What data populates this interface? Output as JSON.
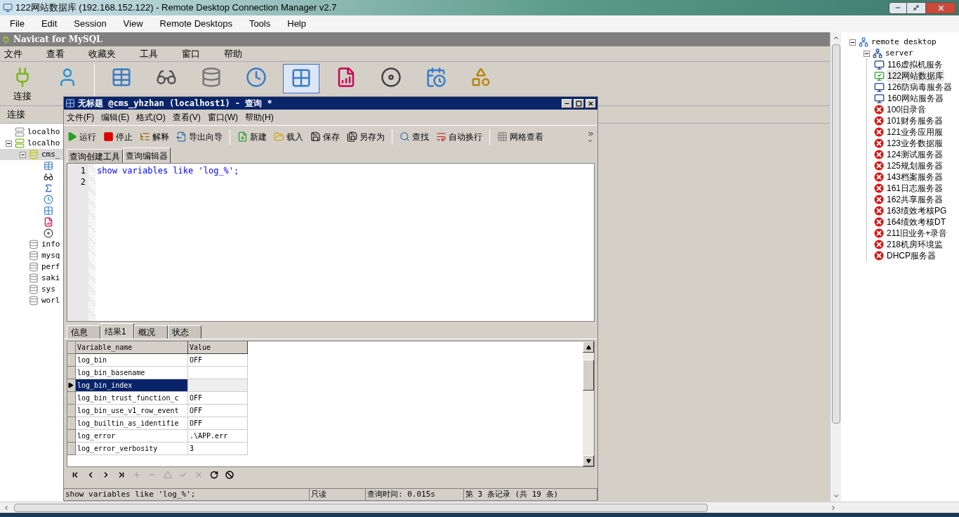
{
  "window": {
    "title": "122网站数据库 (192.168.152.122) - Remote Desktop Connection Manager v2.7"
  },
  "menu": [
    "File",
    "Edit",
    "Session",
    "View",
    "Remote Desktops",
    "Tools",
    "Help"
  ],
  "navicat": {
    "title": "Navicat for MySQL",
    "menu": [
      "文件",
      "查看",
      "收藏夹",
      "工具",
      "窗口",
      "帮助"
    ],
    "toolbar": [
      {
        "kind": "connection",
        "label": "连接",
        "selected": false
      },
      {
        "kind": "user",
        "selected": false
      },
      {
        "kind": "table",
        "selected": false
      },
      {
        "kind": "view",
        "selected": false
      },
      {
        "kind": "function",
        "selected": false
      },
      {
        "kind": "event",
        "selected": false
      },
      {
        "kind": "query",
        "selected": true
      },
      {
        "kind": "report",
        "selected": false
      },
      {
        "kind": "backup",
        "selected": false
      },
      {
        "kind": "schedule",
        "selected": false
      },
      {
        "kind": "model",
        "selected": false
      }
    ],
    "sidebar_header": "连接",
    "tree": [
      {
        "label": "localho",
        "kind": "server"
      },
      {
        "label": "localho",
        "kind": "server-open",
        "expanded": true,
        "children": [
          {
            "label": "cms_",
            "kind": "database-open",
            "expanded": true,
            "selected": true,
            "children": [
              {
                "kind": "tables"
              },
              {
                "kind": "views"
              },
              {
                "kind": "functions"
              },
              {
                "kind": "events"
              },
              {
                "kind": "queries"
              },
              {
                "kind": "reports"
              },
              {
                "kind": "backups"
              }
            ]
          },
          {
            "label": "info",
            "kind": "database",
            "selected": false
          },
          {
            "label": "mysq",
            "kind": "database",
            "selected": false
          },
          {
            "label": "perf",
            "kind": "database",
            "selected": false
          },
          {
            "label": "saki",
            "kind": "database",
            "selected": false
          },
          {
            "label": "sys",
            "kind": "database",
            "selected": false
          },
          {
            "label": "worl",
            "kind": "database",
            "selected": false
          }
        ]
      }
    ]
  },
  "query_window": {
    "title": "无标题 @cms_yhzhan (localhost1) - 查询 *",
    "menu": [
      "文件(F)",
      "编辑(E)",
      "格式(O)",
      "查看(V)",
      "窗口(W)",
      "帮助(H)"
    ],
    "toolbar": [
      {
        "kind": "run",
        "label": "运行"
      },
      {
        "kind": "stop",
        "label": "停止"
      },
      {
        "kind": "explain",
        "label": "解释"
      },
      {
        "kind": "export",
        "label": "导出向导"
      },
      {
        "kind": "sep"
      },
      {
        "kind": "new",
        "label": "新建"
      },
      {
        "kind": "load",
        "label": "载入"
      },
      {
        "kind": "save",
        "label": "保存"
      },
      {
        "kind": "saveas",
        "label": "另存为"
      },
      {
        "kind": "sep"
      },
      {
        "kind": "find",
        "label": "查找"
      },
      {
        "kind": "wrap",
        "label": "自动换行"
      },
      {
        "kind": "sep"
      },
      {
        "kind": "grid",
        "label": "网格查看"
      }
    ],
    "tabs": [
      {
        "label": "查询创建工具",
        "selected": false
      },
      {
        "label": "查询编辑器",
        "selected": true
      }
    ],
    "editor": {
      "line_numbers": [
        "1",
        "2"
      ],
      "lines": [
        "show variables like 'log_%';"
      ]
    },
    "result_tabs": [
      {
        "label": "信息",
        "selected": false
      },
      {
        "label": "结果1",
        "selected": true
      },
      {
        "label": "概况",
        "selected": false
      },
      {
        "label": "状态",
        "selected": false
      }
    ],
    "grid": {
      "columns": [
        "Variable_name",
        "Value"
      ],
      "rows": [
        {
          "name": "log_bin",
          "value": "OFF",
          "selected": false
        },
        {
          "name": "log_bin_basename",
          "selected": false
        },
        {
          "name": "log_bin_index",
          "selected": true
        },
        {
          "name": "log_bin_trust_function_c",
          "value": "OFF",
          "selected": false
        },
        {
          "name": "log_bin_use_v1_row_event",
          "value": "OFF",
          "selected": false
        },
        {
          "name": "log_builtin_as_identifie",
          "value": "OFF",
          "selected": false
        },
        {
          "name": "log_error",
          "value": ".\\APP.err",
          "selected": false
        },
        {
          "name": "log_error_verbosity",
          "value": "3",
          "selected": false
        }
      ]
    },
    "status_bar": [
      "show variables like 'log_%';",
      "只读",
      "查询时间: 0.015s",
      "第 3 条记录 (共 19 条)"
    ]
  },
  "remote_tree": {
    "label": "remote desktop",
    "expanded": true,
    "children": [
      {
        "label": "server",
        "expanded": true,
        "children": [
          {
            "label": "116虚拟机服务",
            "kind": "idle",
            "selected": false
          },
          {
            "label": "122网站数据库",
            "kind": "connected",
            "selected": true
          },
          {
            "label": "126防病毒服务器",
            "kind": "idle",
            "selected": false
          },
          {
            "label": "160网站服务器",
            "kind": "idle",
            "selected": false
          },
          {
            "label": "100旧录音",
            "kind": "error",
            "selected": false
          },
          {
            "label": "101财务服务器",
            "kind": "error",
            "selected": false
          },
          {
            "label": "121业务应用服",
            "kind": "error",
            "selected": false
          },
          {
            "label": "123业务数据服",
            "kind": "error",
            "selected": false
          },
          {
            "label": "124测试服务器",
            "kind": "error",
            "selected": false
          },
          {
            "label": "125规划服务器",
            "kind": "error",
            "selected": false
          },
          {
            "label": "143档案服务器",
            "kind": "error",
            "selected": false
          },
          {
            "label": "161日志服务器",
            "kind": "error",
            "selected": false
          },
          {
            "label": "162共享服务器",
            "kind": "error",
            "selected": false
          },
          {
            "label": "163绩效考核PG",
            "kind": "error",
            "selected": false
          },
          {
            "label": "164绩效考核DT",
            "kind": "error",
            "selected": false
          },
          {
            "label": "211旧业务+录音",
            "kind": "error",
            "selected": false
          },
          {
            "label": "218机房环境监",
            "kind": "error",
            "selected": false
          },
          {
            "label": "DHCP服务器",
            "kind": "error",
            "selected": false
          }
        ]
      }
    ]
  }
}
